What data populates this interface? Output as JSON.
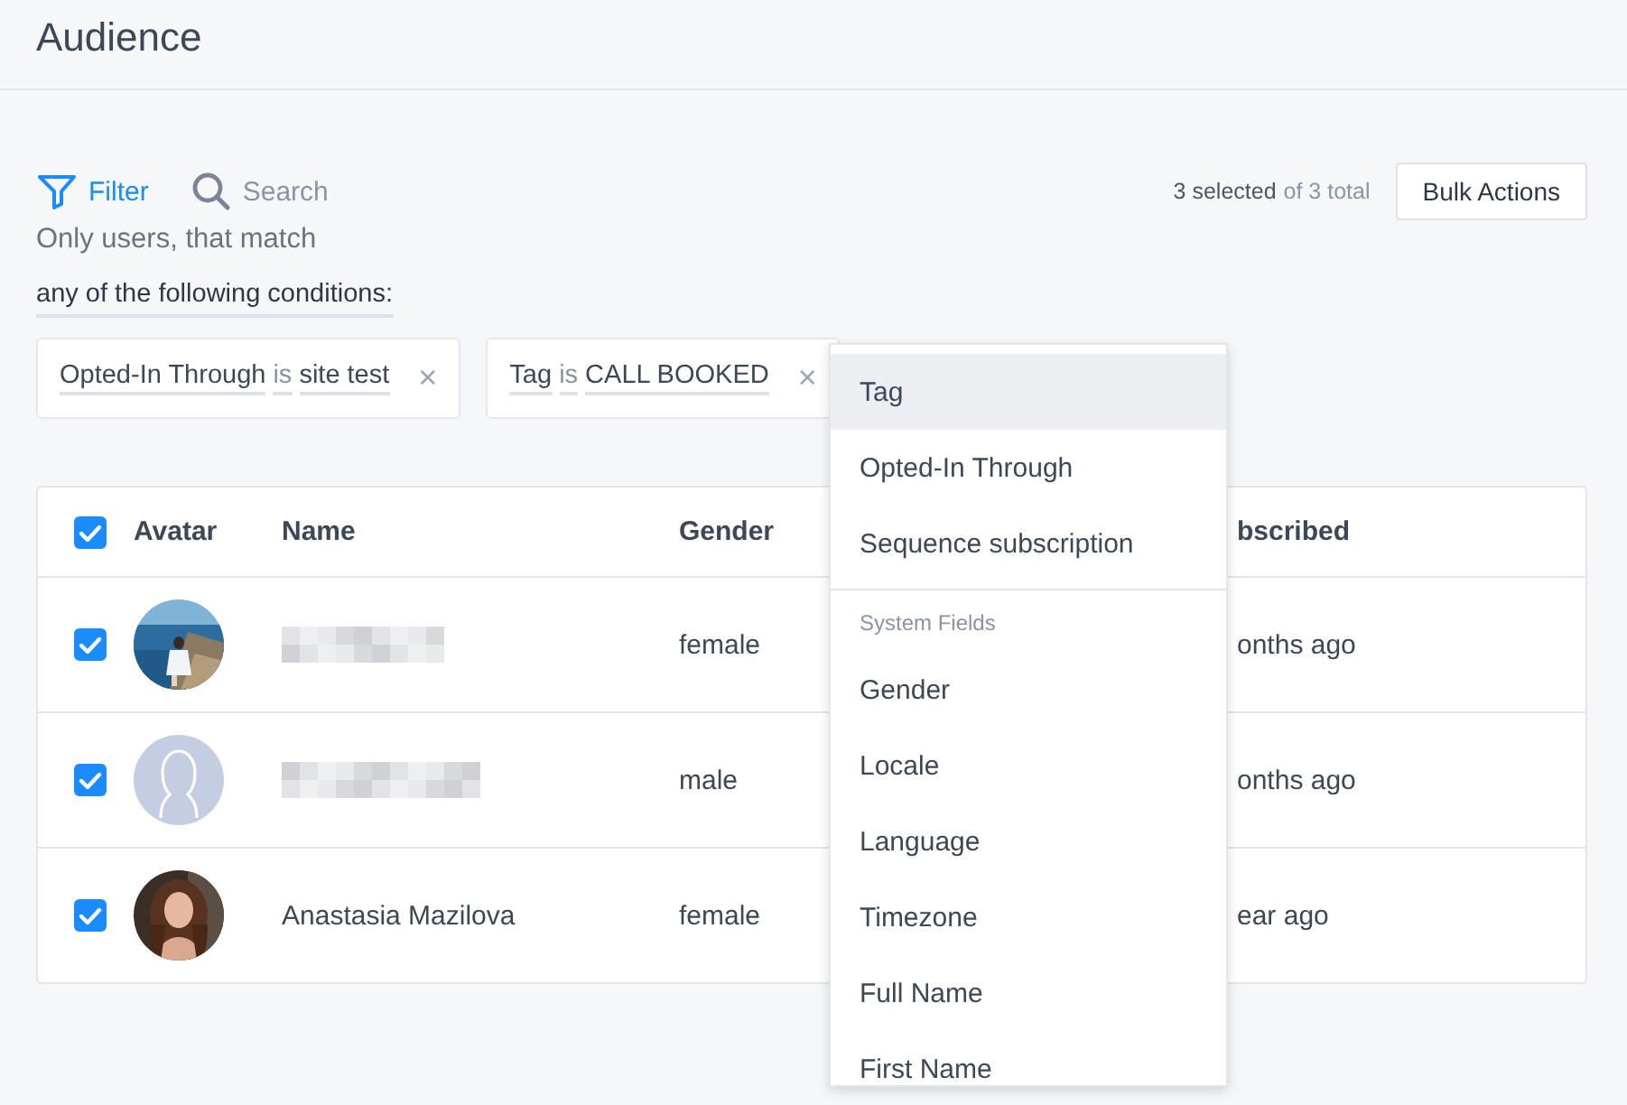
{
  "page": {
    "title": "Audience"
  },
  "toolbar": [
    {
      "kind": "filter",
      "label": "Filter",
      "selected": true
    },
    {
      "kind": "search",
      "label": "Search",
      "selected": false
    }
  ],
  "selection": {
    "selected": "3 selected",
    "total": "of 3 total"
  },
  "bulk_button": "Bulk Actions",
  "match_text": "Only users, that match",
  "match_mode": "any of the following conditions:",
  "conditions": [
    {
      "field": "Opted-In Through",
      "operator": "is",
      "value": "site test",
      "remove": "×"
    },
    {
      "field": "Tag",
      "operator": "is",
      "value": "CALL BOOKED",
      "remove": "×"
    }
  ],
  "table": {
    "select_all": {
      "checked": true
    },
    "columns": [
      "Avatar",
      "Name",
      "Gender",
      "bscribed"
    ],
    "rows": [
      {
        "checked": true,
        "name": {
          "kind": "redacted"
        },
        "gender": "female",
        "column_5": "onths ago"
      },
      {
        "checked": true,
        "avatar": {
          "kind": "placeholder"
        },
        "name": {
          "kind": "redacted"
        },
        "gender": "male",
        "column_5": "onths ago"
      },
      {
        "checked": true,
        "name": {
          "kind": "text",
          "text": "Anastasia Mazilova"
        },
        "gender": "female",
        "column_5": "ear ago"
      }
    ]
  },
  "dropdown": {
    "items": [
      {
        "kind": "option",
        "label": "Tag",
        "selected": true
      },
      {
        "kind": "option",
        "label": "Opted-In Through",
        "selected": false
      },
      {
        "kind": "option",
        "label": "Sequence subscription",
        "selected": false
      },
      {
        "kind": "section",
        "label": "System Fields"
      },
      {
        "kind": "option",
        "label": "Gender",
        "selected": false
      },
      {
        "kind": "option",
        "label": "Locale",
        "selected": false
      },
      {
        "kind": "option",
        "label": "Language",
        "selected": false
      },
      {
        "kind": "option",
        "label": "Timezone",
        "selected": false
      },
      {
        "kind": "option",
        "label": "Full Name",
        "selected": false
      },
      {
        "kind": "option",
        "label": "First Name",
        "selected": false
      }
    ]
  }
}
